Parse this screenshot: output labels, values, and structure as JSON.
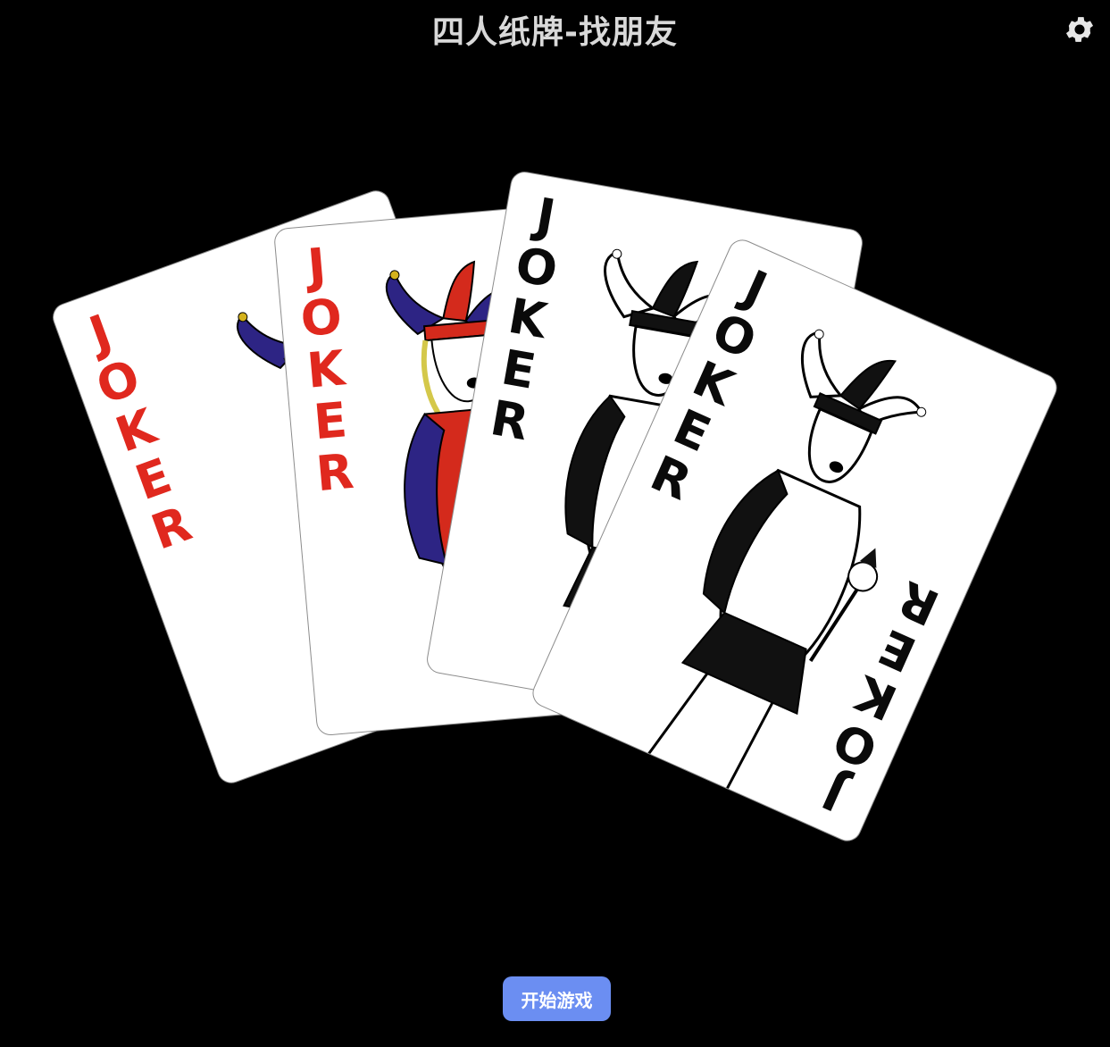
{
  "header": {
    "title": "四人纸牌-找朋友",
    "settings_icon": "gear-icon"
  },
  "cards": [
    {
      "word": "JOKER",
      "color": "red",
      "ink": "#e0281e"
    },
    {
      "word": "JOKER",
      "color": "red",
      "ink": "#e0281e"
    },
    {
      "word": "JOKER",
      "color": "black",
      "ink": "#0a0a0a"
    },
    {
      "word": "JOKER",
      "color": "black",
      "ink": "#0a0a0a"
    }
  ],
  "actions": {
    "start_label": "开始游戏"
  },
  "colors": {
    "background": "#000000",
    "title": "#d9d9d9",
    "button": "#6b8ef2",
    "joker_red": "#e0281e",
    "jester_blue": "#2d2484",
    "jester_red": "#d42a1c"
  }
}
